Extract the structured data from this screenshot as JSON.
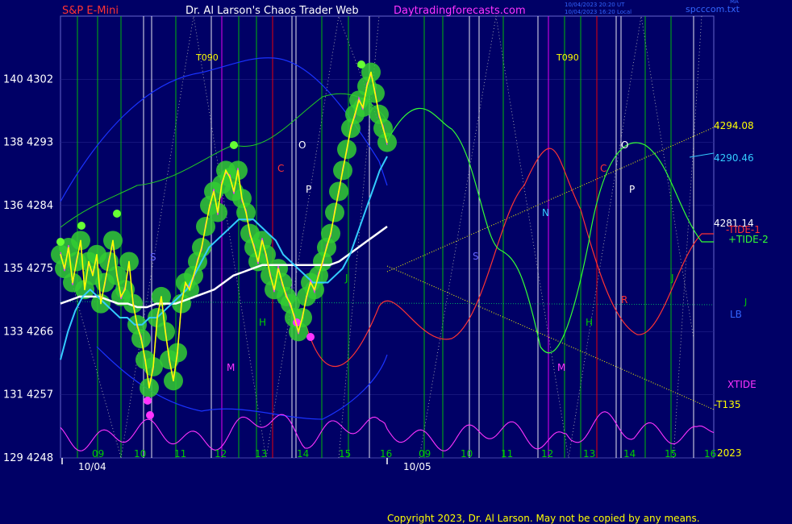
{
  "header": {
    "instrument": "S&P E-Mini",
    "author": "Dr. Al Larson's Chaos Trader Web",
    "site": "Daytradingforecasts.com",
    "timestamp1": "10/04/2023 20:20 UT",
    "timestamp2": "10/04/2023 16:20 Local",
    "tag_top": "MA",
    "datafile": "spcccom.txt"
  },
  "footer": {
    "copyright": "Copyright 2023, Dr. Al Larson. May not be copied by any means."
  },
  "colors": {
    "background": "#000066",
    "grid_white": "#ffffff",
    "grid_green": "#00cc00",
    "grid_red": "#ff0000",
    "grid_magenta": "#ff00ff",
    "price": "#ffff00",
    "bubble": "#33cc33",
    "ma_fast": "#33ccff",
    "ma_slow": "#ffffff",
    "tide1": "#ff3333",
    "tide2": "#33ff33",
    "xtide": "#ff33ff",
    "envelope": "#0000ff"
  },
  "chart_data": {
    "type": "line",
    "title": "S&P E-Mini",
    "ylim": [
      4248,
      4311
    ],
    "y_ticks": [
      {
        "pct": "129",
        "price": "4248"
      },
      {
        "pct": "131",
        "price": "4257"
      },
      {
        "pct": "133",
        "price": "4266"
      },
      {
        "pct": "135",
        "price": "4275"
      },
      {
        "pct": "136",
        "price": "4284"
      },
      {
        "pct": "138",
        "price": "4293"
      },
      {
        "pct": "140",
        "price": "4302"
      }
    ],
    "hour_labels": [
      "09",
      "10",
      "11",
      "12",
      "13",
      "14",
      "15",
      "16",
      "09",
      "10",
      "11",
      "12",
      "13",
      "14",
      "15",
      "16"
    ],
    "date_labels": [
      "10/04",
      "10/05"
    ],
    "price_series": {
      "name": "S&P E-Mini",
      "values": [
        4277,
        4275,
        4278,
        4273,
        4276,
        4279,
        4272,
        4276,
        4274,
        4277,
        4270,
        4273,
        4276,
        4279,
        4274,
        4271,
        4272,
        4276,
        4270,
        4267,
        4265,
        4262,
        4258,
        4261,
        4268,
        4271,
        4266,
        4262,
        4259,
        4263,
        4270,
        4273,
        4272,
        4274,
        4276,
        4278,
        4281,
        4284,
        4286,
        4283,
        4287,
        4289,
        4288,
        4286,
        4289,
        4285,
        4283,
        4280,
        4278,
        4276,
        4279,
        4277,
        4274,
        4272,
        4275,
        4273,
        4271,
        4270,
        4268,
        4266,
        4268,
        4271,
        4273,
        4272,
        4274,
        4276,
        4278,
        4280,
        4283,
        4286,
        4289,
        4292,
        4295,
        4297,
        4299,
        4298,
        4301,
        4303,
        4300,
        4297,
        4295,
        4293
      ]
    },
    "ma_fast": {
      "name": "MA fast",
      "values": [
        4262,
        4266,
        4269,
        4271,
        4272,
        4271,
        4270,
        4269,
        4268,
        4268,
        4267,
        4267,
        4268,
        4268,
        4269,
        4270,
        4271,
        4272,
        4274,
        4276,
        4278,
        4279,
        4280,
        4281,
        4282,
        4282,
        4282,
        4281,
        4280,
        4279,
        4277,
        4276,
        4275,
        4274,
        4273,
        4273,
        4273,
        4274,
        4275,
        4277,
        4280,
        4283,
        4286,
        4289,
        4291
      ]
    },
    "ma_slow": {
      "name": "MA slow",
      "values": [
        4270,
        4270.5,
        4271,
        4271,
        4271,
        4270.5,
        4270,
        4270,
        4269.5,
        4269.5,
        4270,
        4270,
        4270,
        4270.5,
        4271,
        4271.5,
        4272,
        4273,
        4274,
        4274.5,
        4275,
        4275.5,
        4275.5,
        4275.5,
        4275.5,
        4275.5,
        4275.5,
        4275.5,
        4275.5,
        4276,
        4277,
        4278,
        4279,
        4280,
        4281
      ]
    },
    "tide_labels": {
      "tide1": "-TIDE-1",
      "tide2": "+TIDE-2",
      "xtide": "XTIDE",
      "lb": "LB",
      "j": "J",
      "t090": "T090",
      "t135": "-T135",
      "year": "2023"
    },
    "right_values": [
      {
        "label": "4294.08",
        "color": "#ffff00"
      },
      {
        "label": "4290.46",
        "color": "#33ccff"
      },
      {
        "label": "4281.14",
        "color": "#ffffff"
      }
    ],
    "planet_labels": [
      {
        "text": "S",
        "color": "#6666ff"
      },
      {
        "text": "M",
        "color": "#ff33ff"
      },
      {
        "text": "H",
        "color": "#00cc00"
      },
      {
        "text": "C",
        "color": "#ff3333"
      },
      {
        "text": "O",
        "color": "#ffffff"
      },
      {
        "text": "P",
        "color": "#ffffff"
      },
      {
        "text": "J",
        "color": "#00cc00"
      },
      {
        "text": "N",
        "color": "#33ccff"
      },
      {
        "text": "S",
        "color": "#6666ff"
      },
      {
        "text": "M",
        "color": "#ff33ff"
      },
      {
        "text": "H",
        "color": "#00cc00"
      },
      {
        "text": "C",
        "color": "#ff3333"
      },
      {
        "text": "O",
        "color": "#ffffff"
      },
      {
        "text": "P",
        "color": "#ffffff"
      },
      {
        "text": "J",
        "color": "#00cc00"
      },
      {
        "text": "R",
        "color": "#ff3333"
      }
    ]
  }
}
